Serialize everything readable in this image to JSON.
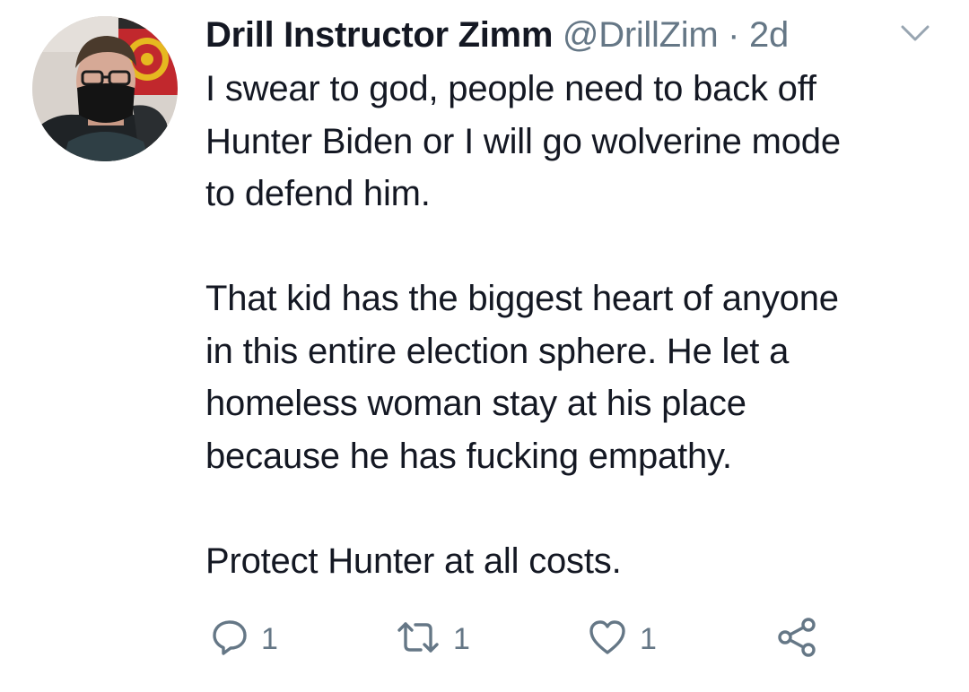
{
  "tweet": {
    "display_name": "Drill Instructor Zimm",
    "handle": "@DrillZim",
    "separator": "·",
    "time": "2d",
    "body": {
      "para1": [
        "I swear to god, people need to back off",
        "Hunter Biden or I will go wolverine mode",
        "to defend him."
      ],
      "para2": [
        "That kid has the biggest heart of anyone",
        "in this entire election sphere. He let a",
        "homeless woman stay at his place",
        "because he has fucking empathy."
      ],
      "para3": [
        "Protect Hunter at all costs."
      ]
    }
  },
  "actions": {
    "reply": {
      "icon": "reply-icon",
      "count": "1"
    },
    "retweet": {
      "icon": "retweet-icon",
      "count": "1"
    },
    "like": {
      "icon": "heart-icon",
      "count": "1"
    },
    "share": {
      "icon": "share-icon"
    }
  },
  "colors": {
    "text": "#141823",
    "secondary": "#657786",
    "background": "#ffffff"
  }
}
